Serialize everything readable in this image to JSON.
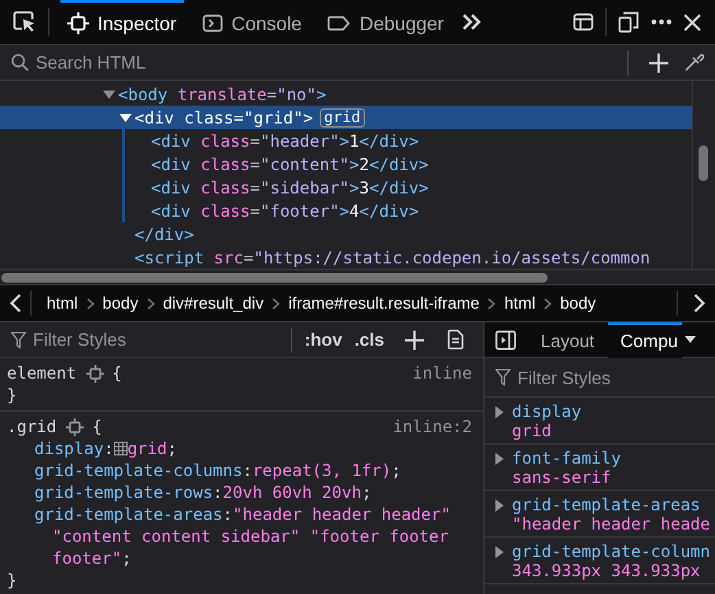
{
  "toolbar": {
    "tabs": [
      {
        "label": "Inspector",
        "kind": "inspector",
        "selected": true
      },
      {
        "label": "Console",
        "kind": "console",
        "selected": false
      },
      {
        "label": "Debugger",
        "kind": "debugger",
        "selected": false
      }
    ]
  },
  "markup": {
    "search": {
      "placeholder": "Search HTML"
    },
    "tree": [
      {
        "open": [
          {
            "kind": "tag",
            "text": "<body"
          },
          {
            "kind": "attr",
            "text": " translate"
          },
          {
            "kind": "punct",
            "text": "="
          },
          {
            "kind": "value",
            "text": "\"no\""
          },
          {
            "kind": "tag",
            "text": ">"
          }
        ],
        "expanded": true,
        "selected": false,
        "children": [
          {
            "open": [
              {
                "kind": "tag",
                "text": "<div"
              },
              {
                "kind": "attr",
                "text": " class"
              },
              {
                "kind": "punct",
                "text": "="
              },
              {
                "kind": "value",
                "text": "\"grid\""
              },
              {
                "kind": "tag",
                "text": ">"
              }
            ],
            "badge": "grid",
            "expanded": true,
            "selected": true,
            "children": [
              {
                "open": [
                  {
                    "kind": "tag",
                    "text": "<div"
                  },
                  {
                    "kind": "attr",
                    "text": " class"
                  },
                  {
                    "kind": "punct",
                    "text": "="
                  },
                  {
                    "kind": "value",
                    "text": "\"header\""
                  },
                  {
                    "kind": "tag",
                    "text": ">"
                  },
                  {
                    "kind": "text",
                    "text": "1"
                  },
                  {
                    "kind": "tag",
                    "text": "</div>"
                  }
                ],
                "selected": false
              },
              {
                "open": [
                  {
                    "kind": "tag",
                    "text": "<div"
                  },
                  {
                    "kind": "attr",
                    "text": " class"
                  },
                  {
                    "kind": "punct",
                    "text": "="
                  },
                  {
                    "kind": "value",
                    "text": "\"content\""
                  },
                  {
                    "kind": "tag",
                    "text": ">"
                  },
                  {
                    "kind": "text",
                    "text": "2"
                  },
                  {
                    "kind": "tag",
                    "text": "</div>"
                  }
                ],
                "selected": false
              },
              {
                "open": [
                  {
                    "kind": "tag",
                    "text": "<div"
                  },
                  {
                    "kind": "attr",
                    "text": " class"
                  },
                  {
                    "kind": "punct",
                    "text": "="
                  },
                  {
                    "kind": "value",
                    "text": "\"sidebar\""
                  },
                  {
                    "kind": "tag",
                    "text": ">"
                  },
                  {
                    "kind": "text",
                    "text": "3"
                  },
                  {
                    "kind": "tag",
                    "text": "</div>"
                  }
                ],
                "selected": false
              },
              {
                "open": [
                  {
                    "kind": "tag",
                    "text": "<div"
                  },
                  {
                    "kind": "attr",
                    "text": " class"
                  },
                  {
                    "kind": "punct",
                    "text": "="
                  },
                  {
                    "kind": "value",
                    "text": "\"footer\""
                  },
                  {
                    "kind": "tag",
                    "text": ">"
                  },
                  {
                    "kind": "text",
                    "text": "4"
                  },
                  {
                    "kind": "tag",
                    "text": "</div>"
                  }
                ],
                "selected": false
              }
            ],
            "close": [
              {
                "kind": "tag",
                "text": "</div>"
              }
            ]
          },
          {
            "open": [
              {
                "kind": "tag",
                "text": "<script"
              },
              {
                "kind": "attr",
                "text": " src"
              },
              {
                "kind": "punct",
                "text": "="
              },
              {
                "kind": "value",
                "text": "\"https://static.codepen.io/assets/common"
              }
            ],
            "selected": false
          }
        ]
      }
    ]
  },
  "breadcrumbs": [
    "html",
    "body",
    "div#result_div",
    "iframe#result.result-iframe",
    "html",
    "body"
  ],
  "rules": {
    "filter": {
      "placeholder": "Filter Styles"
    },
    "pseudo_toggle": ":hov",
    "class_toggle": ".cls",
    "list": [
      {
        "selector": "element",
        "open_brace": "{",
        "source": "inline",
        "close_brace": "}"
      },
      {
        "selector": ".grid",
        "open_brace": "{",
        "source": "inline:2",
        "close_brace": "}",
        "declarations": [
          {
            "name": "display",
            "colon": ":",
            "value": "grid",
            "semicolon": ";",
            "grid_icon": true
          },
          {
            "name": "grid-template-columns",
            "colon": ":",
            "value": "repeat(3, 1fr)",
            "semicolon": ";",
            "grid_icon": false
          },
          {
            "name": "grid-template-rows",
            "colon": ":",
            "value": "20vh 60vh 20vh",
            "semicolon": ";",
            "grid_icon": false
          },
          {
            "name": "grid-template-areas",
            "colon": ":",
            "value": "\"header header header\" \"content content sidebar\" \"footer footer footer\"",
            "semicolon": ";",
            "grid_icon": false
          }
        ]
      }
    ]
  },
  "sidebar": {
    "tabs": [
      {
        "label": "Layout",
        "selected": false
      },
      {
        "label": "Compu",
        "selected": true
      }
    ],
    "filter": {
      "placeholder": "Filter Styles"
    },
    "computed": [
      {
        "name": "display",
        "value": "grid",
        "expanded": false
      },
      {
        "name": "font-family",
        "value": "sans-serif",
        "expanded": false
      },
      {
        "name": "grid-template-areas",
        "value": "\"header header heade",
        "expanded": false
      },
      {
        "name": "grid-template-column",
        "value": "343.933px 343.933px",
        "expanded": false
      }
    ]
  }
}
